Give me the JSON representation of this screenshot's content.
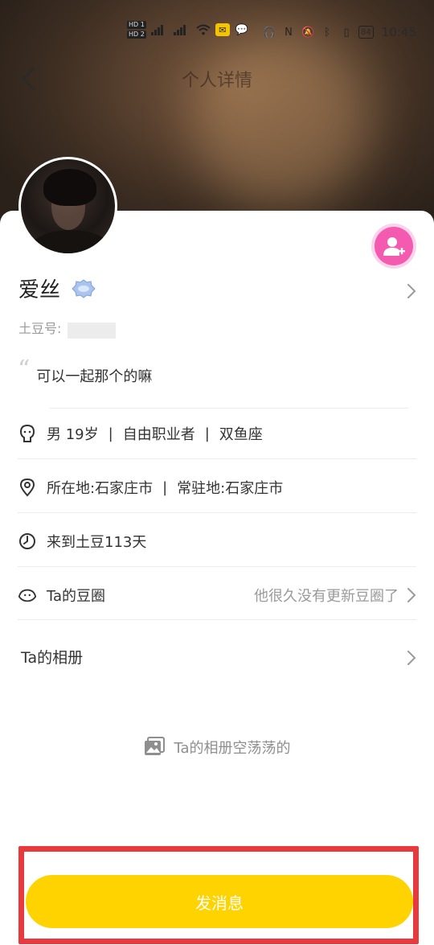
{
  "status_bar": {
    "hd1": "HD 1",
    "hd2": "HD 2",
    "battery": "84",
    "time": "10:45"
  },
  "nav": {
    "title": "个人详情",
    "back_icon": "chevron-left-icon",
    "more_icon": "more-dots-icon",
    "more_label": "···"
  },
  "profile": {
    "name": "爱丝",
    "id_label": "土豆号:",
    "bio": "可以一起那个的嘛",
    "quote_mark": "“"
  },
  "info": {
    "basic": [
      "男 19岁",
      "自由职业者",
      "双鱼座"
    ],
    "separator": "|",
    "location": "所在地:石家庄市",
    "residence": "常驻地:石家庄市",
    "days": "来到土豆113天",
    "circle_label": "Ta的豆圈",
    "circle_status": "他很久没有更新豆圈了"
  },
  "album": {
    "title": "Ta的相册",
    "empty_text": "Ta的相册空荡荡的"
  },
  "actions": {
    "send_message": "发消息"
  },
  "colors": {
    "accent_yellow": "#ffd300",
    "follow_pink": "#f45ab0",
    "highlight_red": "#e8393c",
    "vip_blue": "#8fb3e8"
  }
}
